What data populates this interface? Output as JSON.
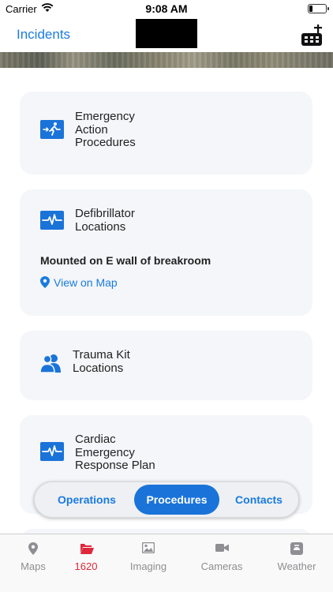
{
  "status_bar": {
    "carrier": "Carrier",
    "time": "9:08 AM"
  },
  "nav": {
    "back_label": "Incidents"
  },
  "cards": [
    {
      "title": "Emergency\nAction\nProcedures",
      "icon": "emergency-exit-icon"
    },
    {
      "title": "Defibrillator\nLocations",
      "icon": "heartbeat-icon",
      "detail": "Mounted on E wall of breakroom",
      "link": "View on Map"
    },
    {
      "title": "Trauma Kit\nLocations",
      "icon": "users-icon"
    },
    {
      "title": "Cardiac\nEmergency\nResponse Plan",
      "icon": "heartbeat-icon"
    }
  ],
  "segments": [
    {
      "label": "Operations",
      "active": false
    },
    {
      "label": "Procedures",
      "active": true
    },
    {
      "label": "Contacts",
      "active": false
    }
  ],
  "tabs": [
    {
      "label": "Maps",
      "icon": "map-pin-icon"
    },
    {
      "label": "1620",
      "icon": "folder-open-icon",
      "active": true
    },
    {
      "label": "Imaging",
      "icon": "image-icon"
    },
    {
      "label": "Cameras",
      "icon": "video-camera-icon"
    },
    {
      "label": "Weather",
      "icon": "weather-icon"
    }
  ],
  "colors": {
    "accent": "#1a7be0",
    "active_tab": "#e0263a",
    "card_bg": "#f4f6f9"
  }
}
